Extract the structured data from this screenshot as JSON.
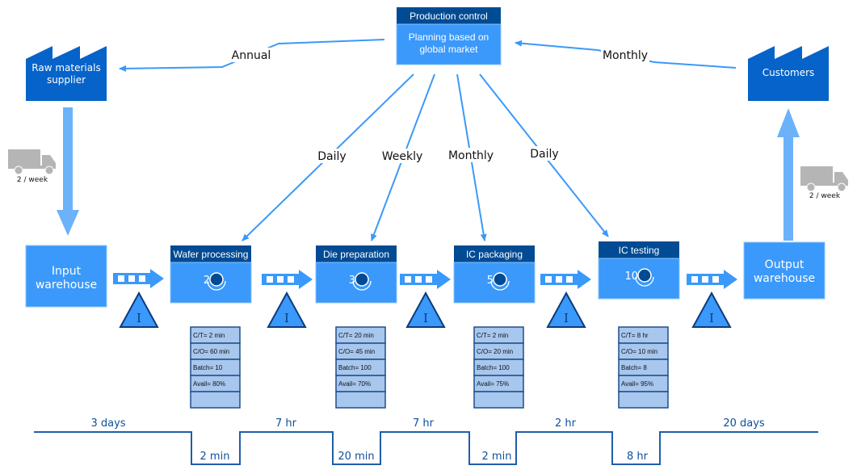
{
  "colors": {
    "factory": "#0563c9",
    "process_fill": "#3a99fa",
    "process_header": "#004b94",
    "arrow": "#3a99fa",
    "push_arrow": "#6bb2fb",
    "data_box": "#a8c7ee",
    "data_border": "#1f4f88",
    "timeline": "#1f5ea8",
    "truck": "#b5b5b5"
  },
  "production_control": {
    "title": "Production control",
    "body_line1": "Planning based on",
    "body_line2": "global market"
  },
  "supplier": {
    "label_line1": "Raw materials",
    "label_line2": "supplier",
    "icon": "factory-icon"
  },
  "customer": {
    "label": "Customers",
    "icon": "factory-icon"
  },
  "info_flows": {
    "to_supplier": "Annual",
    "from_customer": "Monthly",
    "to_processes": [
      "Daily",
      "Weekly",
      "Monthly",
      "Daily"
    ]
  },
  "shipments": {
    "inbound": {
      "icon": "truck-icon",
      "label": "2 / week"
    },
    "outbound": {
      "icon": "truck-icon",
      "label": "2 / week"
    }
  },
  "warehouses": {
    "input": {
      "line1": "Input",
      "line2": "warehouse"
    },
    "output": {
      "line1": "Output",
      "line2": "warehouse"
    }
  },
  "inventory_symbol": "I",
  "processes": [
    {
      "name": "Wafer processing",
      "operators": "2",
      "data": [
        "C/T= 2 min",
        "C/O= 60 min",
        "Batch= 10",
        "Avail= 80%",
        ""
      ]
    },
    {
      "name": "Die preparation",
      "operators": "3",
      "data": [
        "C/T= 20 min",
        "C/O= 45 min",
        "Batch= 100",
        "Avail= 70%",
        ""
      ]
    },
    {
      "name": "IC packaging",
      "operators": "5",
      "data": [
        "C/T= 2 min",
        "C/O= 20 min",
        "Batch= 100",
        "Avail= 75%",
        ""
      ]
    },
    {
      "name": "IC testing",
      "operators": "10",
      "data": [
        "C/T= 8 hr",
        "C/O= 10 min",
        "Batch= 8",
        "Avail= 95%",
        ""
      ]
    }
  ],
  "timeline": {
    "wait_times": [
      "3 days",
      "7 hr",
      "7 hr",
      "2 hr",
      "20 days"
    ],
    "process_times": [
      "2 min",
      "20 min",
      "2 min",
      "8 hr"
    ]
  }
}
